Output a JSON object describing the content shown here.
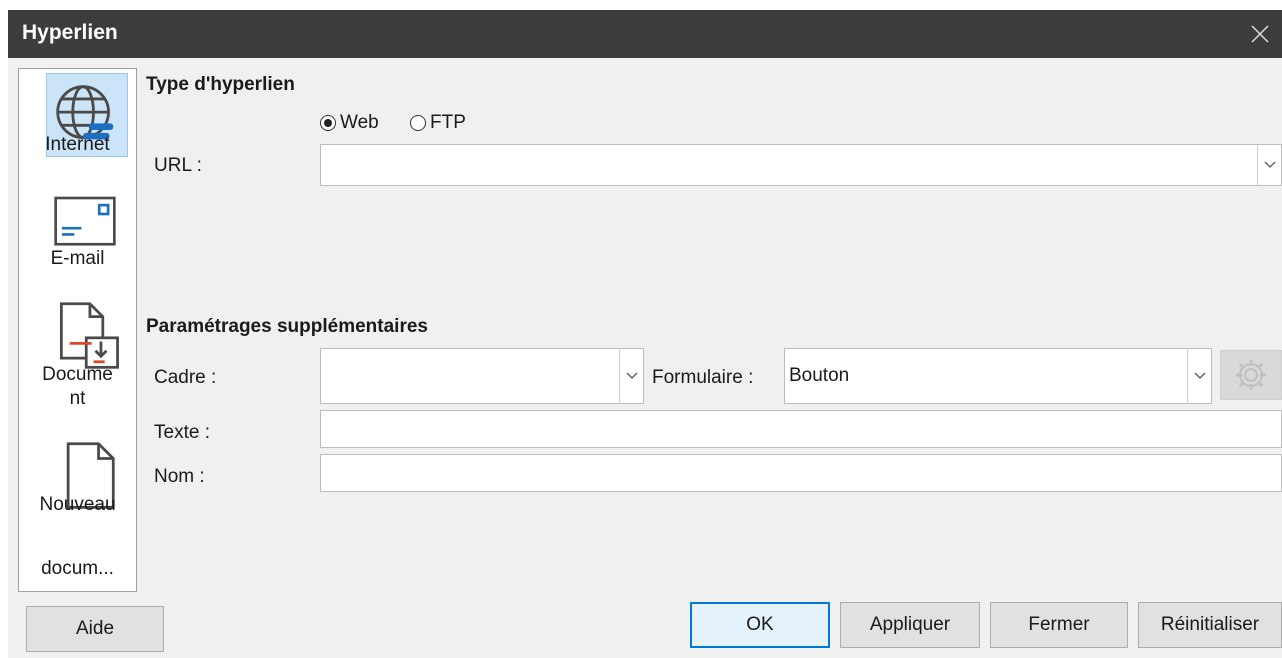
{
  "window": {
    "title": "Hyperlien"
  },
  "sidebar": {
    "items": [
      {
        "label": "Internet",
        "icon": "globe-icon"
      },
      {
        "label": "E-mail",
        "icon": "envelope-icon"
      },
      {
        "label": "Docume\nnt",
        "icon": "document-icon"
      },
      {
        "label_line1": "Nouveau",
        "label_line2": "docum...",
        "icon": "new-document-icon"
      }
    ]
  },
  "hyperlink_type": {
    "title": "Type d'hyperlien",
    "web_label": "Web",
    "ftp_label": "FTP",
    "selected": "Web",
    "url_label": "URL :",
    "url_value": ""
  },
  "extra": {
    "title": "Paramétrages supplémentaires",
    "frame_label": "Cadre :",
    "frame_value": "",
    "form_label": "Formulaire :",
    "form_value": "Bouton",
    "text_label": "Texte :",
    "text_value": "",
    "name_label": "Nom :",
    "name_value": ""
  },
  "buttons": {
    "help": "Aide",
    "ok": "OK",
    "apply": "Appliquer",
    "close": "Fermer",
    "reset": "Réinitialiser"
  },
  "colors": {
    "accent": "#0078d7",
    "icon_blue": "#1e6fc0",
    "icon_red": "#d9472b"
  }
}
